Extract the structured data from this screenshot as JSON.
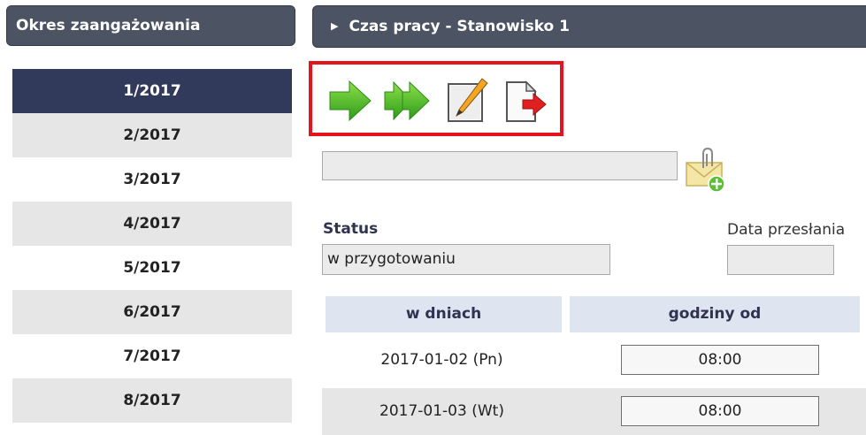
{
  "left_panel": {
    "title": "Okres zaangażowania",
    "periods": [
      "1/2017",
      "2/2017",
      "3/2017",
      "4/2017",
      "5/2017",
      "6/2017",
      "7/2017",
      "8/2017"
    ],
    "selected_period": "1/2017"
  },
  "right_panel": {
    "title": "Czas pracy - Stanowisko 1"
  },
  "toolbar": {
    "icons": [
      "next-arrow-icon",
      "double-next-arrow-icon",
      "edit-pencil-icon",
      "export-document-icon"
    ]
  },
  "form": {
    "note_value": "",
    "status_label": "Status",
    "status_value": "w przygotowaniu",
    "date_label": "Data przesłania",
    "date_value": ""
  },
  "table": {
    "headers": [
      "w dniach",
      "godziny od"
    ],
    "rows": [
      {
        "date": "2017-01-02 (Pn)",
        "from": "08:00"
      },
      {
        "date": "2017-01-03 (Wt)",
        "from": "08:00"
      }
    ]
  },
  "colors": {
    "header_bg": "#4c5363",
    "selected_period_bg": "#323a5c",
    "highlight_border": "#e3141e",
    "table_header_bg": "#dfe4f1"
  }
}
